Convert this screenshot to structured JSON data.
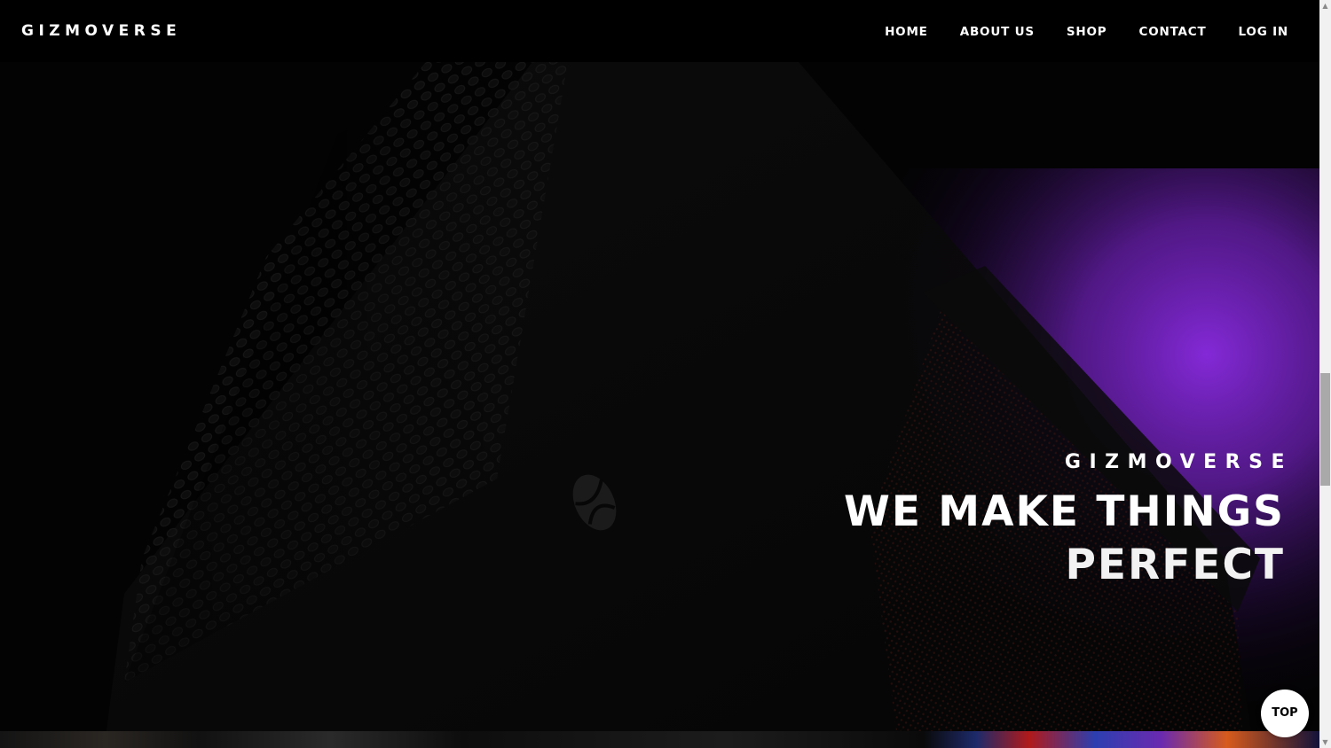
{
  "brand": {
    "logo_text": "GIZMOVERSE"
  },
  "nav": {
    "items": [
      {
        "label": "HOME"
      },
      {
        "label": "ABOUT US"
      },
      {
        "label": "SHOP"
      },
      {
        "label": "CONTACT"
      },
      {
        "label": "LOG IN"
      }
    ]
  },
  "hero": {
    "eyebrow": "GIZMOVERSE",
    "headline_line1": "WE MAKE THINGS",
    "headline_line2": "PERFECT"
  },
  "top_button": {
    "label": "TOP"
  },
  "colors": {
    "background": "#000000",
    "text": "#ffffff",
    "accent_glow": "#7b22c9"
  }
}
